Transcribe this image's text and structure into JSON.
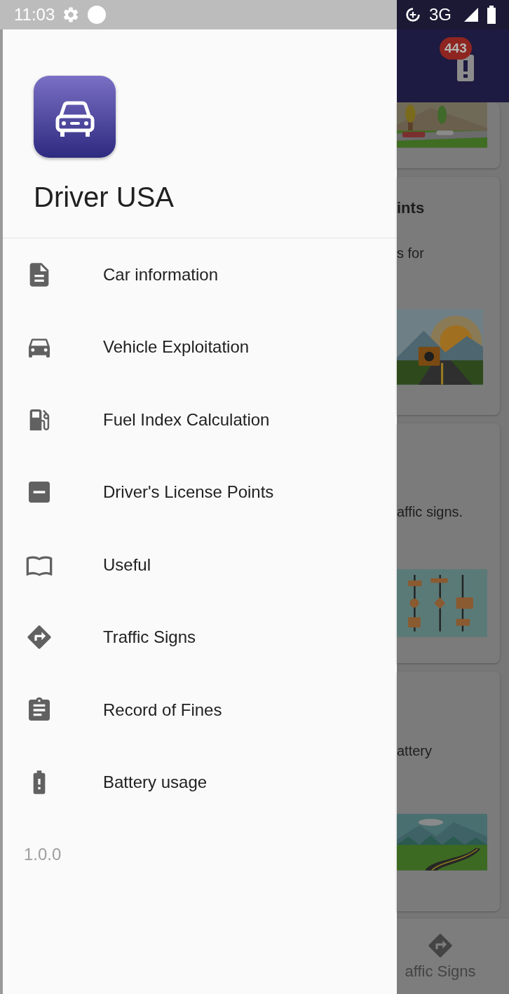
{
  "status_bar": {
    "time": "11:03",
    "network": "3G"
  },
  "drawer": {
    "app_name": "Driver USA",
    "items": [
      {
        "label": "Car information",
        "kind": "document"
      },
      {
        "label": "Vehicle Exploitation",
        "kind": "car"
      },
      {
        "label": "Fuel Index Calculation",
        "kind": "fuel"
      },
      {
        "label": "Driver's License Points",
        "kind": "minus"
      },
      {
        "label": "Useful",
        "kind": "book"
      },
      {
        "label": "Traffic Signs",
        "kind": "directions"
      },
      {
        "label": "Record of Fines",
        "kind": "clipboard"
      },
      {
        "label": "Battery usage",
        "kind": "battery"
      }
    ],
    "version": "1.0.0"
  },
  "background": {
    "app_bar": {
      "badge": "443"
    },
    "cards": [
      {
        "picture": {
          "kind": "picture"
        }
      },
      {
        "title": "ints",
        "text": "s for",
        "picture": {
          "kind": "picture"
        }
      },
      {
        "text": "affic signs.",
        "picture": {
          "kind": "picture"
        }
      },
      {
        "text": "attery",
        "picture": {
          "kind": "picture"
        }
      }
    ],
    "bottom_nav": {
      "label": "affic Signs"
    }
  }
}
